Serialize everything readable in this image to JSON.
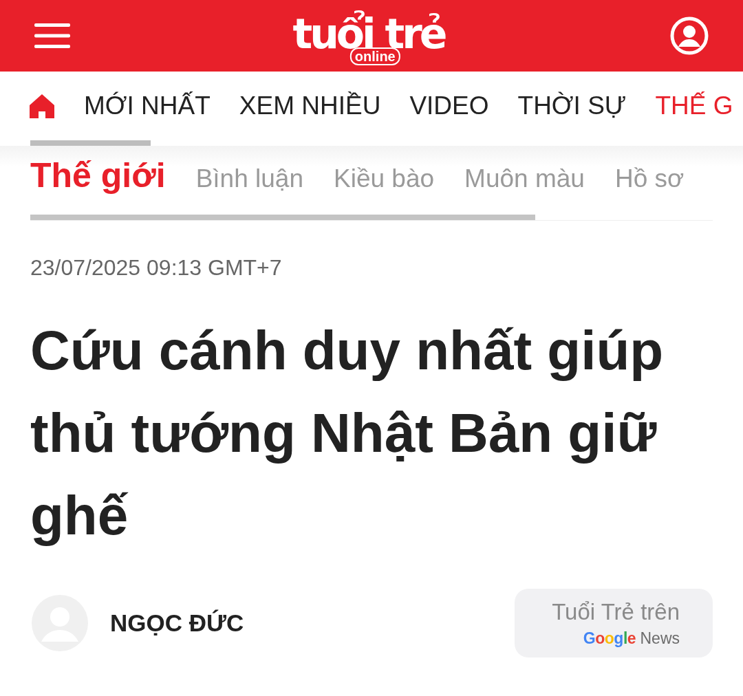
{
  "header": {
    "logo": {
      "main": "tuổi trẻ",
      "sub": "online"
    }
  },
  "nav": [
    {
      "label": "MỚI NHẤT",
      "selected": false
    },
    {
      "label": "XEM NHIỀU",
      "selected": false
    },
    {
      "label": "VIDEO",
      "selected": false
    },
    {
      "label": "THỜI SỰ",
      "selected": false
    },
    {
      "label": "THẾ G",
      "selected": true
    }
  ],
  "subnav": [
    {
      "label": "Thế giới",
      "selected": true
    },
    {
      "label": "Bình luận",
      "selected": false
    },
    {
      "label": "Kiều bào",
      "selected": false
    },
    {
      "label": "Muôn màu",
      "selected": false
    },
    {
      "label": "Hồ sơ",
      "selected": false
    }
  ],
  "article": {
    "date": "23/07/2025 09:13 GMT+7",
    "title": "Cứu cánh duy nhất giúp thủ tướng Nhật Bản giữ ghế",
    "author": "NGỌC ĐỨC"
  },
  "google_news": {
    "text": "Tuổi Trẻ trên",
    "brand": "Google",
    "product": "News"
  }
}
